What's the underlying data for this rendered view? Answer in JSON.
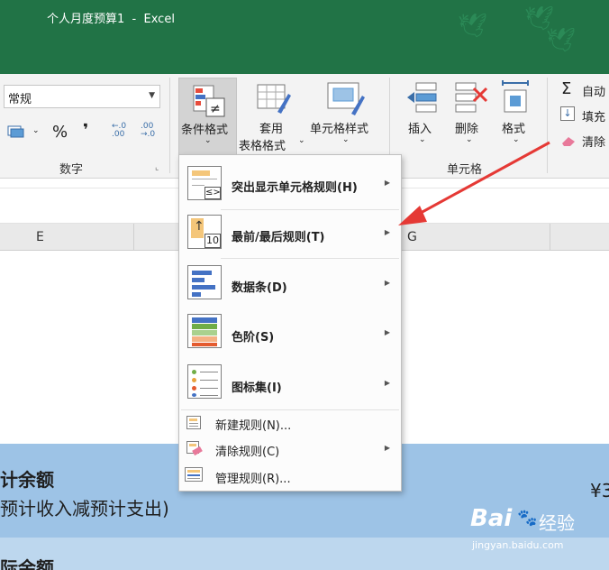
{
  "window": {
    "title": "个人月度预算1  -  Excel"
  },
  "ribbon": {
    "number_format_value": "常规",
    "currency_symbol": "%",
    "comma_symbol": "❜",
    "dec_increase": "←.0\n.00",
    "dec_decrease": ".00\n→.0",
    "number_group": "数字",
    "conditional_format": "条件格式",
    "format_as_table_line1": "套用",
    "format_as_table_line2": "表格格式",
    "cell_styles": "单元格样式",
    "insert": "插入",
    "delete": "删除",
    "format": "格式",
    "cells_group": "单元格",
    "autosum": "自动",
    "fill": "填充",
    "clear": "清除"
  },
  "sheet": {
    "col_e": "E",
    "col_g": "G",
    "band1_title": "计余额",
    "band1_sub": "预计收入减预计支出)",
    "band1_value": "¥3",
    "band2_title": "际余额"
  },
  "menu": {
    "items": [
      {
        "label": "突出显示单元格规则(H)",
        "icon_text": "≤>"
      },
      {
        "label": "最前/最后规则(T)",
        "icon_text": "10"
      },
      {
        "label": "数据条(D)"
      },
      {
        "label": "色阶(S)"
      },
      {
        "label": "图标集(I)"
      },
      {
        "label": "新建规则(N)..."
      },
      {
        "label": "清除规则(C)"
      },
      {
        "label": "管理规则(R)..."
      }
    ]
  },
  "watermark": {
    "brand": "Bai",
    "brand2": "经验",
    "url": "jingyan.baidu.com"
  },
  "colors": {
    "title_bar": "#217346",
    "arrow": "#e53935",
    "band1": "#9dc3e6",
    "band2": "#bdd7ee"
  }
}
